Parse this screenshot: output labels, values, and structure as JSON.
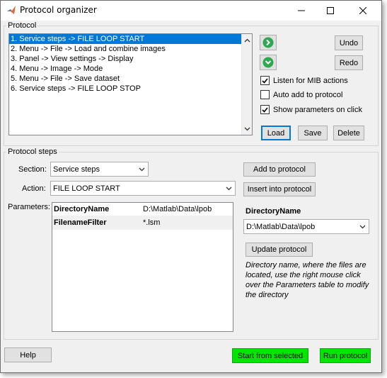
{
  "window": {
    "title": "Protocol organizer"
  },
  "protocol": {
    "group_label": "Protocol",
    "items": [
      "1. Service steps -> FILE LOOP START",
      "2. Menu -> File -> Load and combine images",
      "3. Panel -> View settings -> Display",
      "4. Menu -> Image -> Mode",
      "5. Menu -> File -> Save dataset",
      "6. Service steps -> FILE LOOP STOP"
    ],
    "selected_index": 0,
    "undo_label": "Undo",
    "redo_label": "Redo",
    "listen_label": "Listen for MIB actions",
    "listen_checked": true,
    "auto_add_label": "Auto add to protocol",
    "auto_add_checked": false,
    "show_params_label": "Show parameters on click",
    "show_params_checked": true,
    "load_label": "Load",
    "save_label": "Save",
    "delete_label": "Delete"
  },
  "steps": {
    "group_label": "Protocol steps",
    "section_label": "Section:",
    "section_value": "Service steps",
    "action_label": "Action:",
    "action_value": "FILE LOOP START",
    "parameters_label": "Parameters:",
    "parameters": [
      {
        "key": "DirectoryName",
        "value": "D:\\Matlab\\Data\\lpob"
      },
      {
        "key": "FilenameFilter",
        "value": "*.lsm"
      }
    ],
    "add_label": "Add to protocol",
    "insert_label": "Insert into protocol",
    "param_name": "DirectoryName",
    "param_value": "D:\\Matlab\\Data\\lpob",
    "update_label": "Update protocol",
    "description": "Directory name, where the files are located, use the right mouse click over the Parameters table to modify the directory"
  },
  "footer": {
    "help_label": "Help",
    "start_selected_label": "Start from selected",
    "run_label": "Run protocol"
  },
  "colors": {
    "selection": "#0078d7",
    "run_button": "#00e600",
    "nav_circle": "#2fa84f"
  }
}
